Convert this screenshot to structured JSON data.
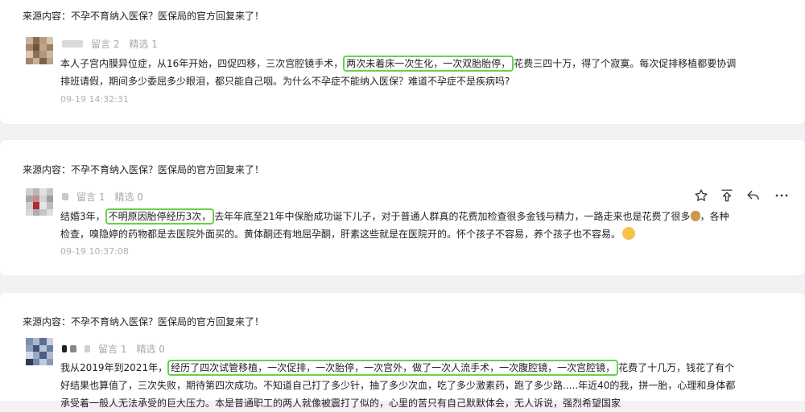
{
  "comments": [
    {
      "source": "来源内容：不孕不育纳入医保？医保局的官方回复来了！",
      "replies": "留言 2",
      "featured": "精选 1",
      "content_before": "本人子宫内膜异位症，从16年开始，四促四移，三次宫腔镜手术，",
      "content_highlight": "两次未着床一次生化，一次双胎胎停，",
      "content_after": "花费三四十万，得了个寂寞。每次促排移植都要协调排班请假，期间多少委屈多少眼泪，都只能自己咽。为什么不孕症不能纳入医保？难道不孕症不是疾病吗?",
      "timestamp": "09-19 14:32:31"
    },
    {
      "source": "来源内容：不孕不育纳入医保？医保局的官方回复来了！",
      "replies": "留言 1",
      "featured": "精选 0",
      "content_before": "结婚3年，",
      "content_highlight": "不明原因胎停经历3次，",
      "content_after": "去年年底至21年中保胎成功诞下儿子，对于普通人群真的花费加检查很多金钱与精力，一路走来也是花费了很多",
      "content_after2": "，各种检查，嗅隐婷的药物都是去医院外面买的。黄体酮还有地屈孕酮，肝素这些就是在医院开的。怀个孩子不容易，养个孩子也不容易。",
      "timestamp": "09-19 10:37:08"
    },
    {
      "source": "来源内容：不孕不育纳入医保？医保局的官方回复来了！",
      "replies": "留言 1",
      "featured": "精选 0",
      "content_before": "我从2019年到2021年，",
      "content_highlight": "经历了四次试管移植，一次促排，一次胎停，一次宫外，做了一次人流手术，一次腹腔镜，一次宫腔镜，",
      "content_after": "花费了十几万，钱花了有个好结果也算值了，三次失败，期待第四次成功。不知道自己打了多少针，抽了多少次血，吃了多少激素药，跑了多少路.....年近40的我，拼一胎，心理和身体都承受着一般人无法承受的巨大压力。本是普通职工的两人就像被震打了似的，心里的苦只有自己默默体会，无人诉说，强烈希望国家"
    }
  ],
  "icons": [
    "star-icon",
    "pin-top-icon",
    "reply-icon",
    "more-icon",
    "money-bag-emoji",
    "sad-face-emoji"
  ],
  "colors": {
    "highlight": "#6dcf4a",
    "meta": "#a8a8ac",
    "background": "#f2f2f4"
  }
}
